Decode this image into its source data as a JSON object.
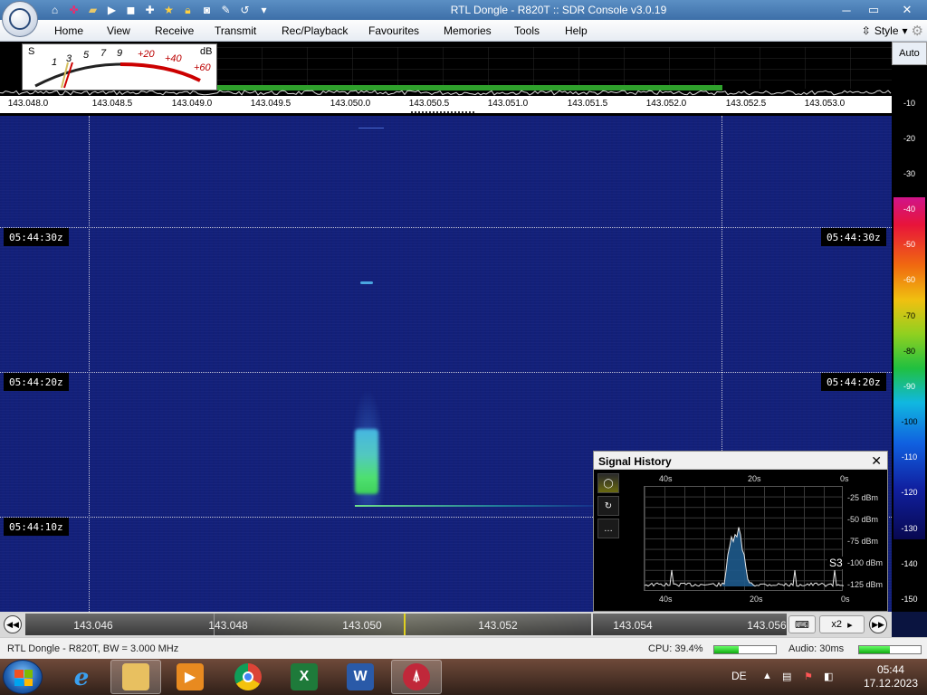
{
  "window": {
    "title": "RTL Dongle - R820T :: SDR Console v3.0.19"
  },
  "quick_access": {
    "icons": [
      "home-icon",
      "lifebuoy-icon",
      "folder-icon",
      "play-icon",
      "stop-icon",
      "plus-icon",
      "star-icon",
      "lock-icon",
      "camera-icon",
      "pen-icon",
      "undo-icon",
      "dropdown-icon"
    ]
  },
  "menu": {
    "tabs": [
      {
        "label": "Home"
      },
      {
        "label": "View"
      },
      {
        "label": "Receive"
      },
      {
        "label": "Transmit"
      },
      {
        "label": "Rec/Playback"
      },
      {
        "label": "Favourites"
      },
      {
        "label": "Memories"
      },
      {
        "label": "Tools"
      },
      {
        "label": "Help"
      }
    ],
    "style_label": "Style"
  },
  "smeter": {
    "s_label": "S",
    "db_label": "dB",
    "scale": [
      "1",
      "3",
      "5",
      "7",
      "9"
    ],
    "plus_scale": [
      "+20",
      "+40",
      "+60"
    ]
  },
  "freq_ruler": {
    "ticks": [
      "143.048.0",
      "143.048.5",
      "143.049.0",
      "143.049.5",
      "143.050.0",
      "143.050.5",
      "143.051.0",
      "143.051.5",
      "143.052.0",
      "143.052.5",
      "143.053.0"
    ]
  },
  "waterfall": {
    "timestamps": [
      {
        "left": "05:44:30z",
        "right": "05:44:30z"
      },
      {
        "left": "05:44:20z",
        "right": "05:44:20z"
      },
      {
        "left": "05:44:10z",
        "right": ""
      }
    ]
  },
  "db_scale": {
    "auto_label": "Auto",
    "labels": [
      "-10",
      "-20",
      "-30",
      "-40",
      "-50",
      "-60",
      "-70",
      "-80",
      "-90",
      "-100",
      "-110",
      "-120",
      "-130",
      "-140",
      "-150"
    ]
  },
  "signal_history": {
    "title": "Signal History",
    "close_label": "✕",
    "top_x": [
      "40s",
      "20s",
      "0s"
    ],
    "bottom_x": [
      "40s",
      "20s",
      "0s"
    ],
    "y_labels": [
      "-25 dBm",
      "-50 dBm",
      "-75 dBm",
      "-100 dBm",
      "-125 dBm"
    ],
    "s_reading": "S3",
    "tool_labels": [
      "",
      "",
      ""
    ]
  },
  "freq_bar": {
    "labels": [
      "143.046",
      "143.048",
      "143.050",
      "143.052",
      "143.054",
      "143.056"
    ],
    "zoom_label": "x2"
  },
  "status": {
    "device": "RTL Dongle - R820T, BW = 3.000 MHz",
    "cpu": "CPU: 39.4%",
    "cpu_level": 0.39,
    "audio": "Audio: 30ms",
    "audio_level": 0.5
  },
  "taskbar": {
    "apps": [
      {
        "name": "internet-explorer",
        "active": false
      },
      {
        "name": "file-explorer",
        "active": true
      },
      {
        "name": "media-player",
        "active": false
      },
      {
        "name": "chrome",
        "active": false
      },
      {
        "name": "excel",
        "active": false
      },
      {
        "name": "word",
        "active": false
      },
      {
        "name": "sdr-console",
        "active": true
      }
    ],
    "language": "DE",
    "time": "05:44",
    "date": "17.12.2023"
  }
}
